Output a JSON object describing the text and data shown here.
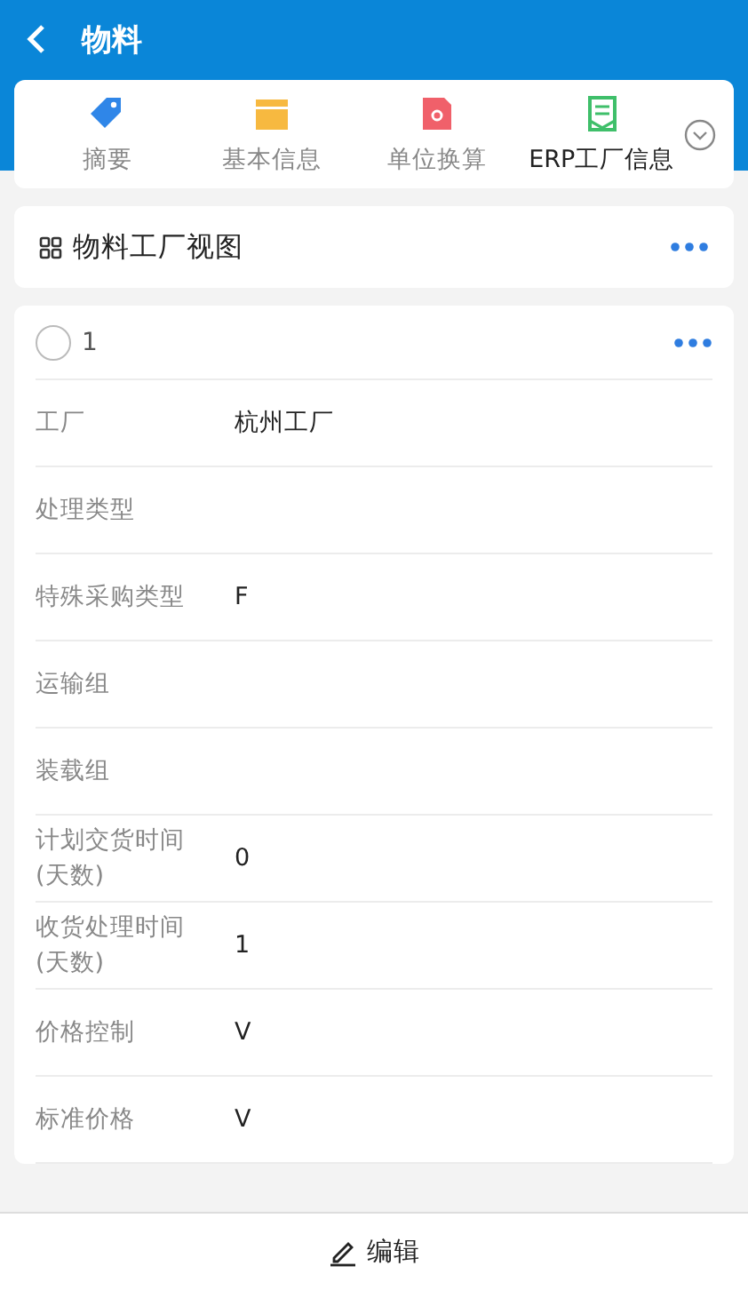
{
  "header": {
    "title": "物料"
  },
  "tabs": [
    {
      "label": "摘要",
      "kind": "tag",
      "selected": false
    },
    {
      "label": "基本信息",
      "kind": "calendar",
      "selected": false
    },
    {
      "label": "单位换算",
      "kind": "disk",
      "selected": false
    },
    {
      "label": "ERP工厂信息",
      "kind": "receipt",
      "selected": true
    }
  ],
  "section": {
    "title": "物料工厂视图"
  },
  "record": {
    "number": "1",
    "checked": false,
    "fields": [
      {
        "label": "工厂",
        "value": "杭州工厂"
      },
      {
        "label": "处理类型"
      },
      {
        "label": "特殊采购类型",
        "value": "F"
      },
      {
        "label": "运输组"
      },
      {
        "label": "装载组"
      },
      {
        "label": "计划交货时间(天数)",
        "value": "0"
      },
      {
        "label": "收货处理时间(天数)",
        "value": "1"
      },
      {
        "label": "价格控制",
        "value": "V"
      },
      {
        "label": "标准价格",
        "value": "V"
      }
    ]
  },
  "footer": {
    "edit": "编辑"
  }
}
